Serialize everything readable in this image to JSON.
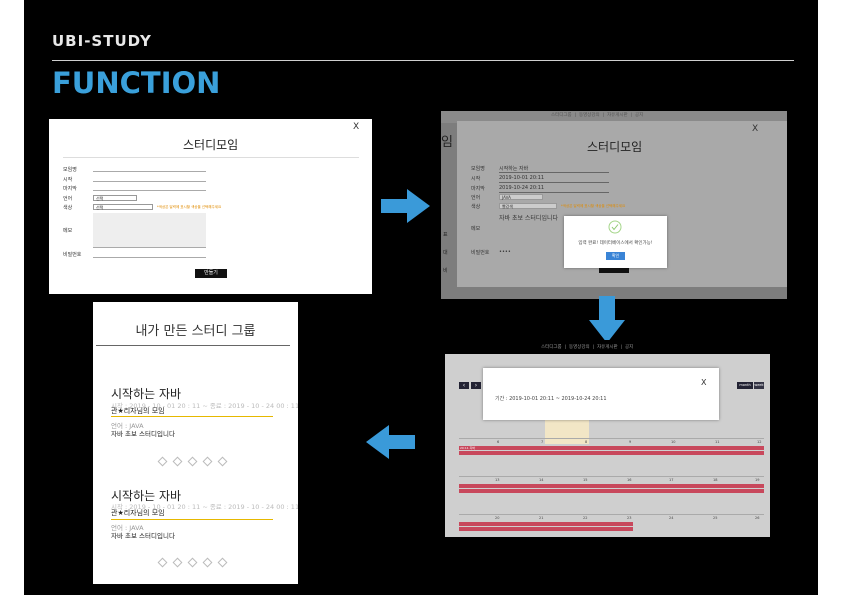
{
  "header": {
    "subtitle": "UBI-STUDY",
    "title": "FUNCTION"
  },
  "colors": {
    "accent": "#3aa0db",
    "arrow": "#3a9ad9",
    "event_bar": "#c8485c",
    "card_line": "#e6b800"
  },
  "form_shot": {
    "close": "X",
    "title": "스터디모임",
    "labels": [
      "모임명",
      "시작",
      "마지막",
      "언어",
      "색상",
      "메모",
      "비밀번호"
    ],
    "lang_select": "선택",
    "color_select": "선택",
    "hint": "*색상은 달력에 표시할 색상을 선택해주세요",
    "submit": "만들기"
  },
  "confirm_shot": {
    "nav": [
      "스터디그룹",
      "|",
      "동영상강의",
      "|",
      "자유게시판",
      "|",
      "공지"
    ],
    "side_char": "임",
    "close": "X",
    "title": "스터디모임",
    "labels": [
      "모임명",
      "시작",
      "마지막",
      "언어",
      "색상",
      "메모",
      "비밀번호"
    ],
    "values": {
      "name": "시작하는 자바",
      "start": "2019-10-01 20:11",
      "end": "2019-10-24 20:11",
      "lang": "JAVA",
      "color": "빨강색",
      "memo": "자바 초보 스터디입니다",
      "password": "••••"
    },
    "hint": "*색상은 달력에 표시할 색상을 선택해주세요",
    "alert_text": "입력 완료! 데이터베이스에서 확인가능!",
    "alert_ok": "확인",
    "left_labels": [
      "표",
      "대",
      "비"
    ]
  },
  "calendar_shot": {
    "nav": [
      "스터디그룹",
      "|",
      "동영상강의",
      "|",
      "자유게시판",
      "|",
      "공지"
    ],
    "close": "X",
    "period": "기간 : 2019-10-01 20:11 ~ 2019-10-24 20:11",
    "prev": "‹",
    "next": "›",
    "month_btn": "month",
    "week_btn": "week",
    "day_numbers": [
      [
        "6",
        "7",
        "8",
        "9",
        "10",
        "11",
        "12"
      ],
      [
        "13",
        "14",
        "15",
        "16",
        "17",
        "18",
        "19"
      ],
      [
        "20",
        "21",
        "22",
        "23",
        "24",
        "25",
        "26"
      ]
    ],
    "event_label": "20:11 자바"
  },
  "cards_shot": {
    "title": "내가 만든 스터디 그룹",
    "cards": [
      {
        "name": "시작하는 자바",
        "period": "시작 : 2019 - 10 - 01 20 : 11  ~  종료 : 2019 - 10 - 24 00 : 11",
        "group": "관★리자님의 모임",
        "lang": "언어 : JAVA",
        "desc": "자바 초보 스터디입니다"
      },
      {
        "name": "시작하는 자바",
        "period": "시작 : 2019 - 10 - 01 20 : 11  ~  종료 : 2019 - 10 - 24 00 : 11",
        "group": "관★리자님의 모임",
        "lang": "언어 : JAVA",
        "desc": "자바 초보 스터디입니다"
      }
    ]
  }
}
